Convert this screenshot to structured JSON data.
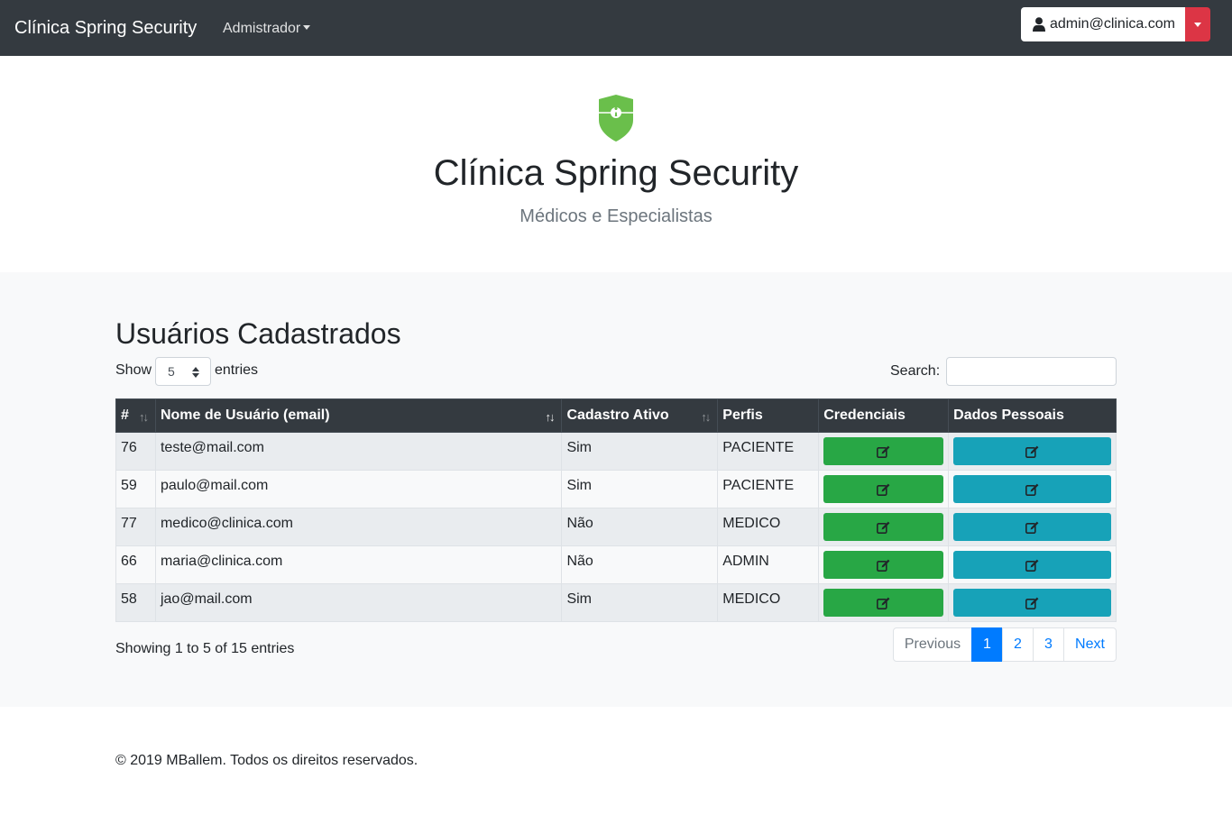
{
  "navbar": {
    "brand": "Clínica Spring Security",
    "menu_label": "Admistrador",
    "user_email": "admin@clinica.com",
    "user_toggle_color": "#dc3545"
  },
  "hero": {
    "title": "Clínica Spring Security",
    "subtitle": "Médicos e Especialistas",
    "shield_color": "#6abf4b"
  },
  "main": {
    "title": "Usuários Cadastrados",
    "show_label": "Show",
    "page_length": "5",
    "entries_label": "entries",
    "search_label": "Search:",
    "search_value": ""
  },
  "table": {
    "columns": [
      "#",
      "Nome de Usuário (email)",
      "Cadastro Ativo",
      "Perfis",
      "Credenciais",
      "Dados Pessoais"
    ],
    "rows": [
      {
        "id": "76",
        "email": "teste@mail.com",
        "ativo": "Sim",
        "perfil": "PACIENTE"
      },
      {
        "id": "59",
        "email": "paulo@mail.com",
        "ativo": "Sim",
        "perfil": "PACIENTE"
      },
      {
        "id": "77",
        "email": "medico@clinica.com",
        "ativo": "Não",
        "perfil": "MEDICO"
      },
      {
        "id": "66",
        "email": "maria@clinica.com",
        "ativo": "Não",
        "perfil": "ADMIN"
      },
      {
        "id": "58",
        "email": "jao@mail.com",
        "ativo": "Sim",
        "perfil": "MEDICO"
      }
    ],
    "credenciais_button_color": "#28a745",
    "dados_button_color": "#17a2b8",
    "button_icon": "edit-icon"
  },
  "info_text": "Showing 1 to 5 of 15 entries",
  "pagination": {
    "previous": "Previous",
    "pages": [
      "1",
      "2",
      "3"
    ],
    "active_page": "1",
    "next": "Next"
  },
  "footer": {
    "text": "© 2019 MBallem. Todos os direitos reservados."
  }
}
